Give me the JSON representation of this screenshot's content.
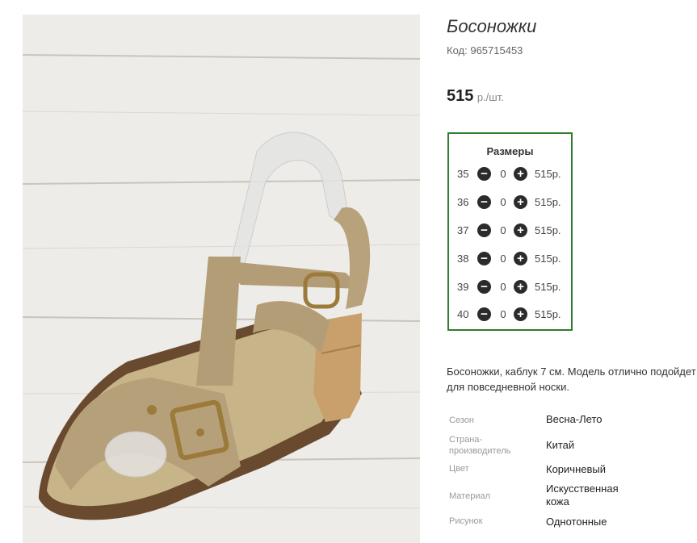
{
  "product": {
    "title": "Босоножки",
    "code_label": "Код:",
    "code": "965715453",
    "price": "515",
    "price_unit": "р./шт."
  },
  "sizes": {
    "heading": "Размеры",
    "rows": [
      {
        "size": "35",
        "qty": "0",
        "price": "515р."
      },
      {
        "size": "36",
        "qty": "0",
        "price": "515р."
      },
      {
        "size": "37",
        "qty": "0",
        "price": "515р."
      },
      {
        "size": "38",
        "qty": "0",
        "price": "515р."
      },
      {
        "size": "39",
        "qty": "0",
        "price": "515р."
      },
      {
        "size": "40",
        "qty": "0",
        "price": "515р."
      }
    ],
    "minus_icon": "minus-circle-icon",
    "plus_icon": "plus-circle-icon"
  },
  "description": {
    "line1": "Босоножки, каблук 7 см. Модель отлично подойдет",
    "line2": "для повседневной носки."
  },
  "properties": [
    {
      "key": "Сезон",
      "value": "Весна-Лето"
    },
    {
      "key": "Страна-производитель",
      "value": "Китай"
    },
    {
      "key": "Цвет",
      "value": "Коричневый"
    },
    {
      "key": "Материал",
      "value": "Искусственная кожа"
    },
    {
      "key": "Рисунок",
      "value": "Однотонные"
    }
  ],
  "colors": {
    "sizes_border": "#2f7d2f",
    "button": "#2b2b2b"
  }
}
